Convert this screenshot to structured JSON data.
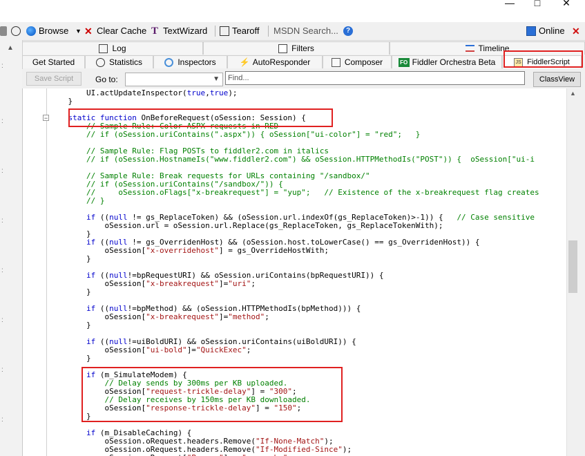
{
  "toolbar": {
    "browse": "Browse",
    "clear_cache": "Clear Cache",
    "text_wizard": "TextWizard",
    "tearoff": "Tearoff",
    "msdn_search": "MSDN Search...",
    "online": "Online"
  },
  "tabs_row1": [
    "Log",
    "Filters",
    "Timeline"
  ],
  "tabs_row2": [
    "Get Started",
    "Statistics",
    "Inspectors",
    "AutoResponder",
    "Composer",
    "Fiddler Orchestra Beta",
    "FiddlerScript"
  ],
  "icon_badges": {
    "orchestra": "FO",
    "script": "JS"
  },
  "script_toolbar": {
    "save_script": "Save Script",
    "goto_label": "Go to:",
    "find_placeholder": "Find...",
    "classview": "ClassView"
  },
  "code_lines": [
    "        UI.actUpdateInspector(true,true);",
    "    }",
    "",
    "    static function OnBeforeRequest(oSession: Session) {",
    "        // Sample Rule: Color ASPX requests in RED",
    "        // if (oSession.uriContains(\".aspx\")) { oSession[\"ui-color\"] = \"red\";   }",
    "",
    "        // Sample Rule: Flag POSTs to fiddler2.com in italics",
    "        // if (oSession.HostnameIs(\"www.fiddler2.com\") && oSession.HTTPMethodIs(\"POST\")) {  oSession[\"ui-i",
    "",
    "        // Sample Rule: Break requests for URLs containing \"/sandbox/\"",
    "        // if (oSession.uriContains(\"/sandbox/\")) {",
    "        //     oSession.oFlags[\"x-breakrequest\"] = \"yup\";   // Existence of the x-breakrequest flag creates",
    "        // }",
    "",
    "        if ((null != gs_ReplaceToken) && (oSession.url.indexOf(gs_ReplaceToken)>-1)) {   // Case sensitive",
    "            oSession.url = oSession.url.Replace(gs_ReplaceToken, gs_ReplaceTokenWith);",
    "        }",
    "        if ((null != gs_OverridenHost) && (oSession.host.toLowerCase() == gs_OverridenHost)) {",
    "            oSession[\"x-overridehost\"] = gs_OverrideHostWith;",
    "        }",
    "",
    "        if ((null!=bpRequestURI) && oSession.uriContains(bpRequestURI)) {",
    "            oSession[\"x-breakrequest\"]=\"uri\";",
    "        }",
    "",
    "        if ((null!=bpMethod) && (oSession.HTTPMethodIs(bpMethod))) {",
    "            oSession[\"x-breakrequest\"]=\"method\";",
    "        }",
    "",
    "        if ((null!=uiBoldURI) && oSession.uriContains(uiBoldURI)) {",
    "            oSession[\"ui-bold\"]=\"QuickExec\";",
    "        }",
    "",
    "        if (m_SimulateModem) {",
    "            // Delay sends by 300ms per KB uploaded.",
    "            oSession[\"request-trickle-delay\"] = \"300\";",
    "            // Delay receives by 150ms per KB downloaded.",
    "            oSession[\"response-trickle-delay\"] = \"150\";",
    "        }",
    "",
    "        if (m_DisableCaching) {",
    "            oSession.oRequest.headers.Remove(\"If-None-Match\");",
    "            oSession.oRequest.headers.Remove(\"If-Modified-Since\");",
    "            oSession.oRequest[\"Pragma\"] = \"no-cache\";"
  ],
  "colors": {
    "keyword": "#0000cc",
    "comment": "#008000",
    "string": "#a31515",
    "highlight_border": "#e02020"
  }
}
